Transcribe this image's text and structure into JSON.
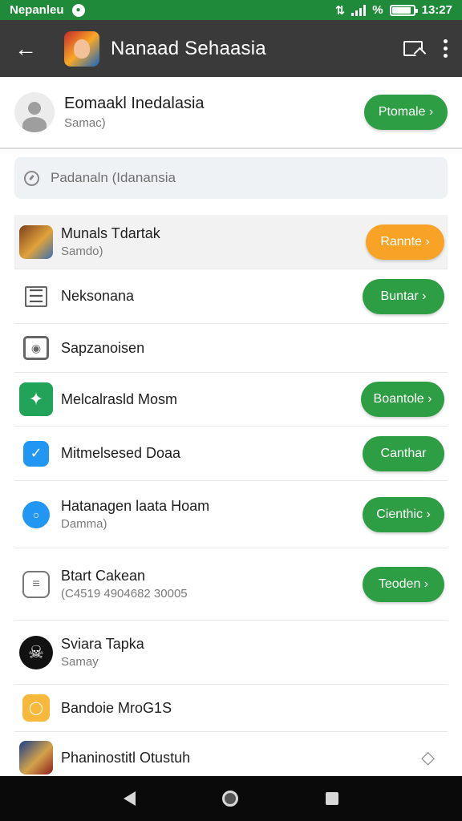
{
  "status_bar": {
    "carrier": "Nepanleu",
    "battery_pct": "%",
    "time": "13:27",
    "battery_level": 0.9,
    "colors": {
      "background": "#1f8a3a"
    }
  },
  "app_bar": {
    "title": "Nanaad Sehaasia",
    "icons": [
      "back-arrow-icon",
      "app-avatar",
      "cast-icon",
      "more-vert-icon"
    ],
    "colors": {
      "background": "#3a3a3a"
    }
  },
  "profile": {
    "name": "Eomaakl Inedalasia",
    "subtitle": "Samac)",
    "button_label": "Ptomale ›"
  },
  "search": {
    "placeholder": "Padanaln (Idanansia"
  },
  "items": [
    {
      "label": "Munals Tdartak",
      "sub": "Samdo)",
      "button": "Rannte ›",
      "button_color": "orange",
      "icon": "game-hero-icon"
    },
    {
      "label": "Neksonana",
      "sub": "",
      "button": "Buntar ›",
      "button_color": "green",
      "icon": "table-grid-icon"
    },
    {
      "label": "Sapzanoisen",
      "sub": "",
      "button": "",
      "button_color": "",
      "icon": "camera-card-icon"
    },
    {
      "label": "Melcalrasld Mosm",
      "sub": "",
      "button": "Boantole ›",
      "button_color": "green",
      "icon": "green-app-icon"
    },
    {
      "label": "Mitmelsesed Doaa",
      "sub": "",
      "button": "Canthar",
      "button_color": "green",
      "icon": "blue-check-icon"
    },
    {
      "label": "Hatanagen laata Hoam",
      "sub": "Damma)",
      "button": "Cienthic ›",
      "button_color": "green",
      "icon": "location-pin-icon"
    },
    {
      "label": "Btart Cakean",
      "sub": "(C4519 4904682 30005",
      "button": "Teoden ›",
      "button_color": "green",
      "icon": "chat-list-icon"
    },
    {
      "label": "Sviara Tapka",
      "sub": "Samay",
      "button": "",
      "button_color": "",
      "icon": "skull-icon"
    },
    {
      "label": "Bandoie MroG1S",
      "sub": "",
      "button": "",
      "button_color": "",
      "icon": "yellow-bulb-icon"
    },
    {
      "label": "Phaninostitl Otustuh",
      "sub": "",
      "button": "",
      "button_color": "",
      "icon": "game-portrait-icon"
    }
  ],
  "colors": {
    "green_button": "#2e9e44",
    "orange_button": "#f9a326"
  }
}
